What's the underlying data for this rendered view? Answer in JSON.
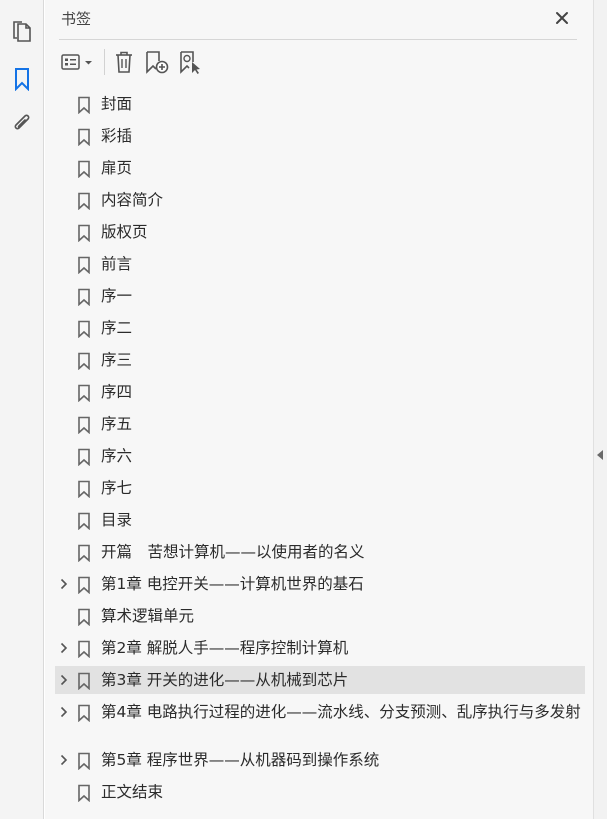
{
  "panel": {
    "title": "书签"
  },
  "bookmarks": [
    {
      "label": "封面",
      "expandable": false
    },
    {
      "label": "彩插",
      "expandable": false
    },
    {
      "label": "扉页",
      "expandable": false
    },
    {
      "label": "内容简介",
      "expandable": false
    },
    {
      "label": "版权页",
      "expandable": false
    },
    {
      "label": "前言",
      "expandable": false
    },
    {
      "label": "序一",
      "expandable": false
    },
    {
      "label": "序二",
      "expandable": false
    },
    {
      "label": "序三",
      "expandable": false
    },
    {
      "label": "序四",
      "expandable": false
    },
    {
      "label": "序五",
      "expandable": false
    },
    {
      "label": "序六",
      "expandable": false
    },
    {
      "label": "序七",
      "expandable": false
    },
    {
      "label": "目录",
      "expandable": false
    },
    {
      "label": "开篇　苦想计算机——以使用者的名义",
      "expandable": false
    },
    {
      "label": "第1章 电控开关——计算机世界的基石",
      "expandable": true
    },
    {
      "label": "算术逻辑单元",
      "expandable": false
    },
    {
      "label": "第2章 解脱人手——程序控制计算机",
      "expandable": true
    },
    {
      "label": "第3章 开关的进化——从机械到芯片",
      "expandable": true,
      "selected": true
    },
    {
      "label": "第4章 电路执行过程的进化——流水线、分支预测、乱序执行与多发射",
      "expandable": true
    },
    {
      "label": "第5章 程序世界——从机器码到操作系统",
      "expandable": true
    },
    {
      "label": "正文结束",
      "expandable": false
    }
  ],
  "icons": {
    "rail": [
      "pages-icon",
      "bookmarks-icon",
      "attachments-icon"
    ],
    "toolbar": [
      "options-icon",
      "delete-icon",
      "new-bookmark-icon",
      "new-bookmark-from-structure-icon"
    ],
    "close": "close-icon",
    "collapse": "collapse-panel-icon"
  },
  "colors": {
    "accent": "#1473e6",
    "selected_row": "#e2e2e2",
    "panel_bg": "#f7f7f7"
  }
}
